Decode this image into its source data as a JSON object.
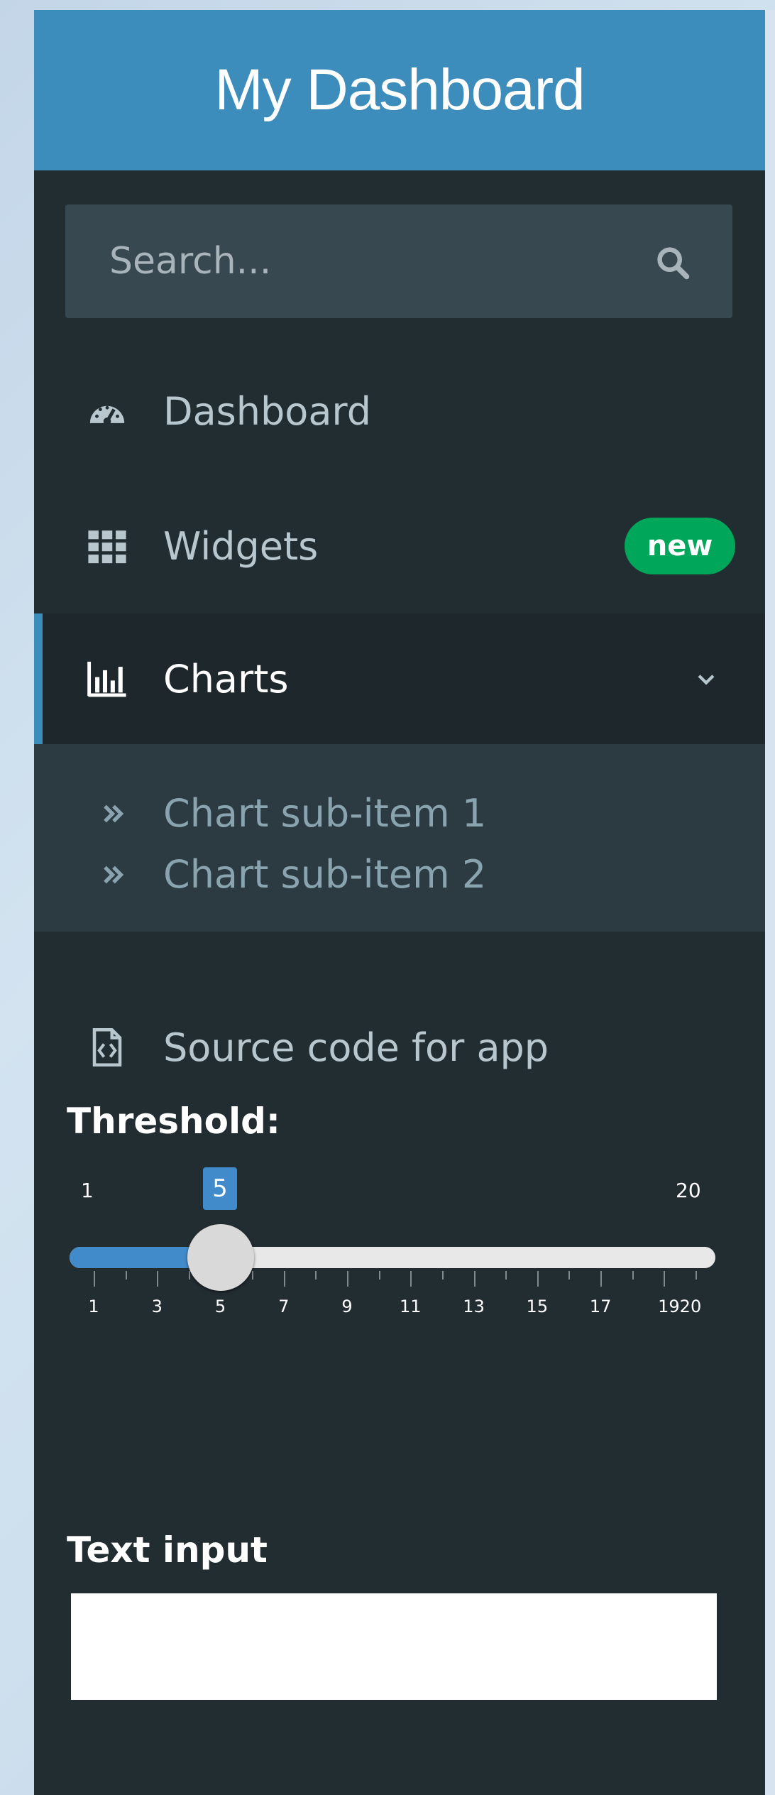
{
  "header": {
    "title": "My Dashboard"
  },
  "search": {
    "placeholder": "Search...",
    "icon": "search-icon"
  },
  "sidebar": {
    "items": [
      {
        "label": "Dashboard",
        "icon": "dashboard-gauge-icon"
      },
      {
        "label": "Widgets",
        "icon": "grid-icon",
        "badge": "new"
      },
      {
        "label": "Charts",
        "icon": "bar-chart-icon",
        "expanded": true,
        "children": [
          {
            "label": "Chart sub-item 1",
            "icon": "double-chevron-right-icon"
          },
          {
            "label": "Chart sub-item 2",
            "icon": "double-chevron-right-icon"
          }
        ]
      },
      {
        "label": "Source code for app",
        "icon": "file-code-icon"
      }
    ]
  },
  "slider": {
    "label": "Threshold:",
    "min": 1,
    "max": 20,
    "value": 5,
    "min_label": "1",
    "max_label": "20",
    "value_label": "5",
    "tick_labels": [
      "1",
      "3",
      "5",
      "7",
      "9",
      "11",
      "13",
      "15",
      "17",
      "1920"
    ]
  },
  "text_input": {
    "label": "Text input",
    "value": ""
  },
  "colors": {
    "header": "#3c8dbc",
    "sidebar_bg": "#222d32",
    "active_bg": "#1e282c",
    "submenu_bg": "#2c3b41",
    "badge_green": "#00a65a",
    "slider_blue": "#428bca"
  }
}
